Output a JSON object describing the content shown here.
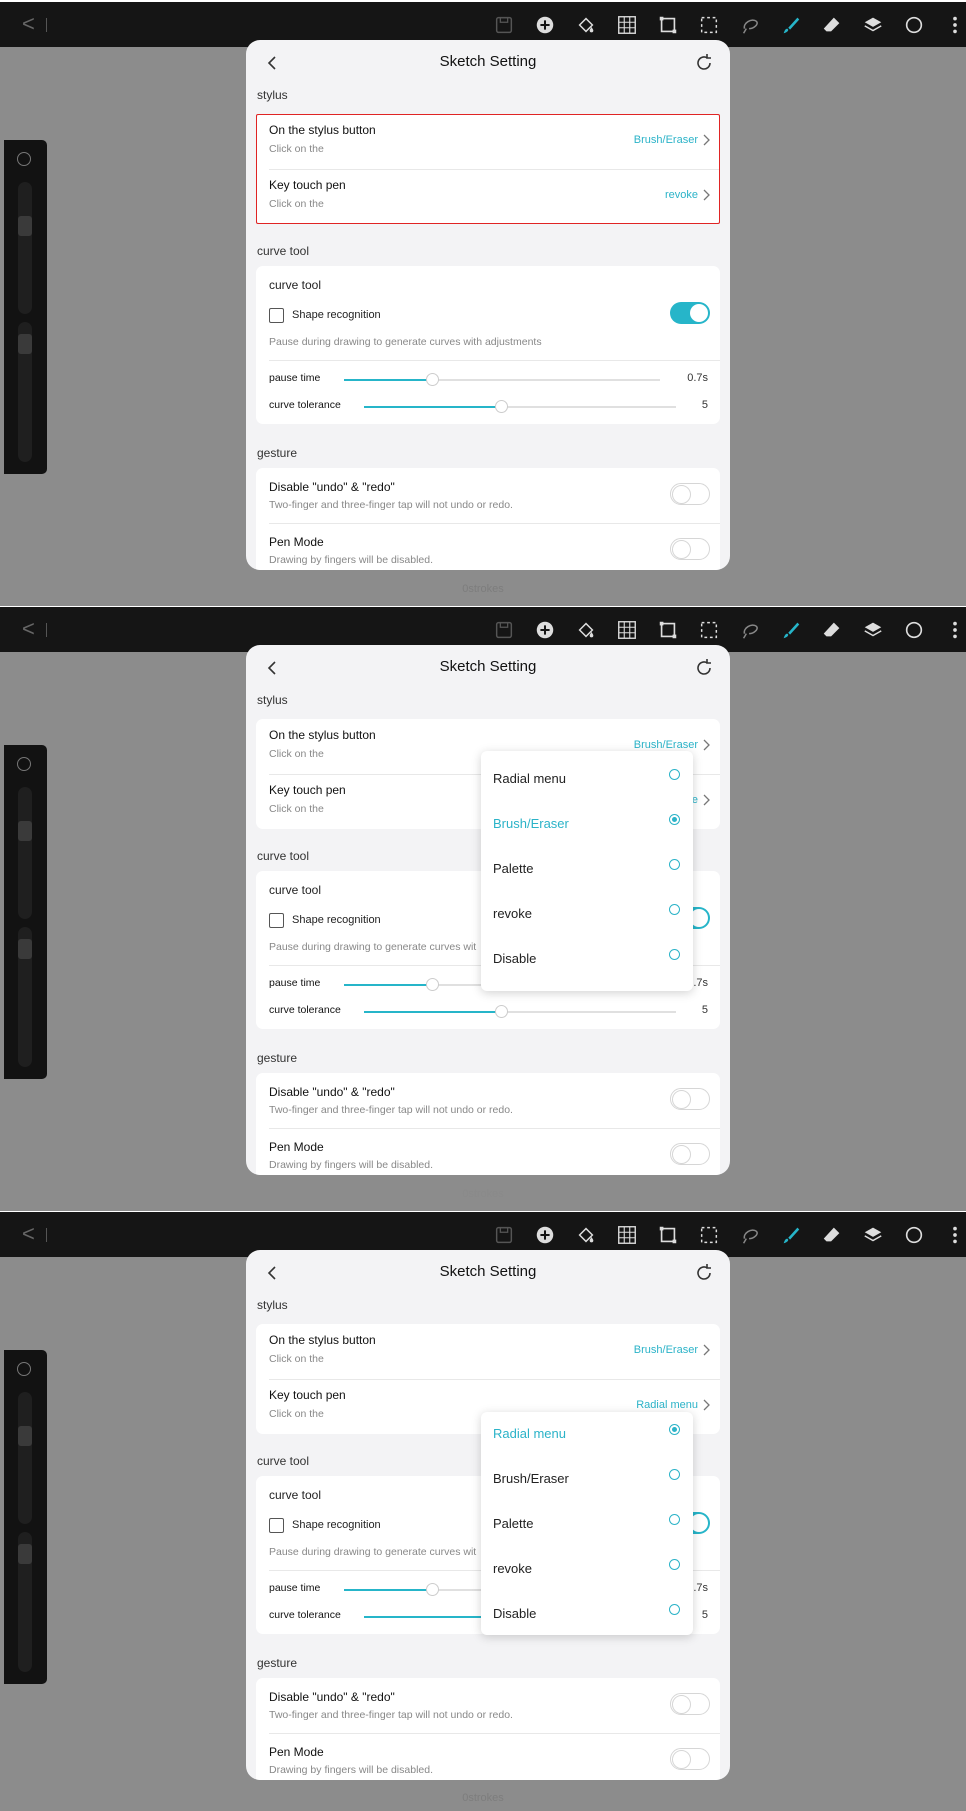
{
  "toolbar": {
    "back": "<",
    "separator": "|"
  },
  "strokes_label": "0strokes",
  "settings": {
    "title": "Sketch Setting",
    "stylus_section": "stylus",
    "stylus_button": {
      "title": "On the stylus button",
      "sub": "Click on the",
      "value": "Brush/Eraser"
    },
    "key_touch_pen": {
      "title": "Key touch pen",
      "sub": "Click on the",
      "value_frame1": "revoke",
      "value_frame2": "e",
      "value_frame3": "Radial menu"
    },
    "curve_section": "curve tool",
    "curve_tool": {
      "title": "curve tool",
      "shape_recognition": "Shape recognition",
      "desc": "Pause during drawing to generate curves with adjustments",
      "desc_cut": "Pause during drawing to generate curves wit",
      "desc_cut3": "Pause during drawing to generate curves wit",
      "pause_time_label": "pause time",
      "pause_time_value": "0.7s",
      "pause_time_value_cut": ".7s",
      "pause_time_fraction": 0.28,
      "tolerance_label": "curve tolerance",
      "tolerance_value": "5",
      "tolerance_fraction": 0.44,
      "toggle_on": true
    },
    "gesture_section": "gesture",
    "disable_undo": {
      "title": "Disable \"undo\" & \"redo\"",
      "sub": "Two-finger and three-finger tap will not undo or redo.",
      "on": false
    },
    "pen_mode": {
      "title": "Pen Mode",
      "sub": "Drawing by fingers will be disabled.",
      "on": false
    }
  },
  "menu_options": [
    "Radial menu",
    "Brush/Eraser",
    "Palette",
    "revoke",
    "Disable"
  ],
  "frame2_selected": "Brush/Eraser",
  "frame3_selected": "Radial menu",
  "colors": {
    "accent": "#26b5c9",
    "highlight": "#e02424",
    "toolbar": "#151515"
  },
  "icons": [
    "save-icon",
    "add-icon",
    "fill-icon",
    "grid-icon",
    "transform-icon",
    "selection-icon",
    "lasso-icon",
    "brush-icon",
    "eraser-icon",
    "layers-icon",
    "color-icon",
    "more-icon"
  ]
}
